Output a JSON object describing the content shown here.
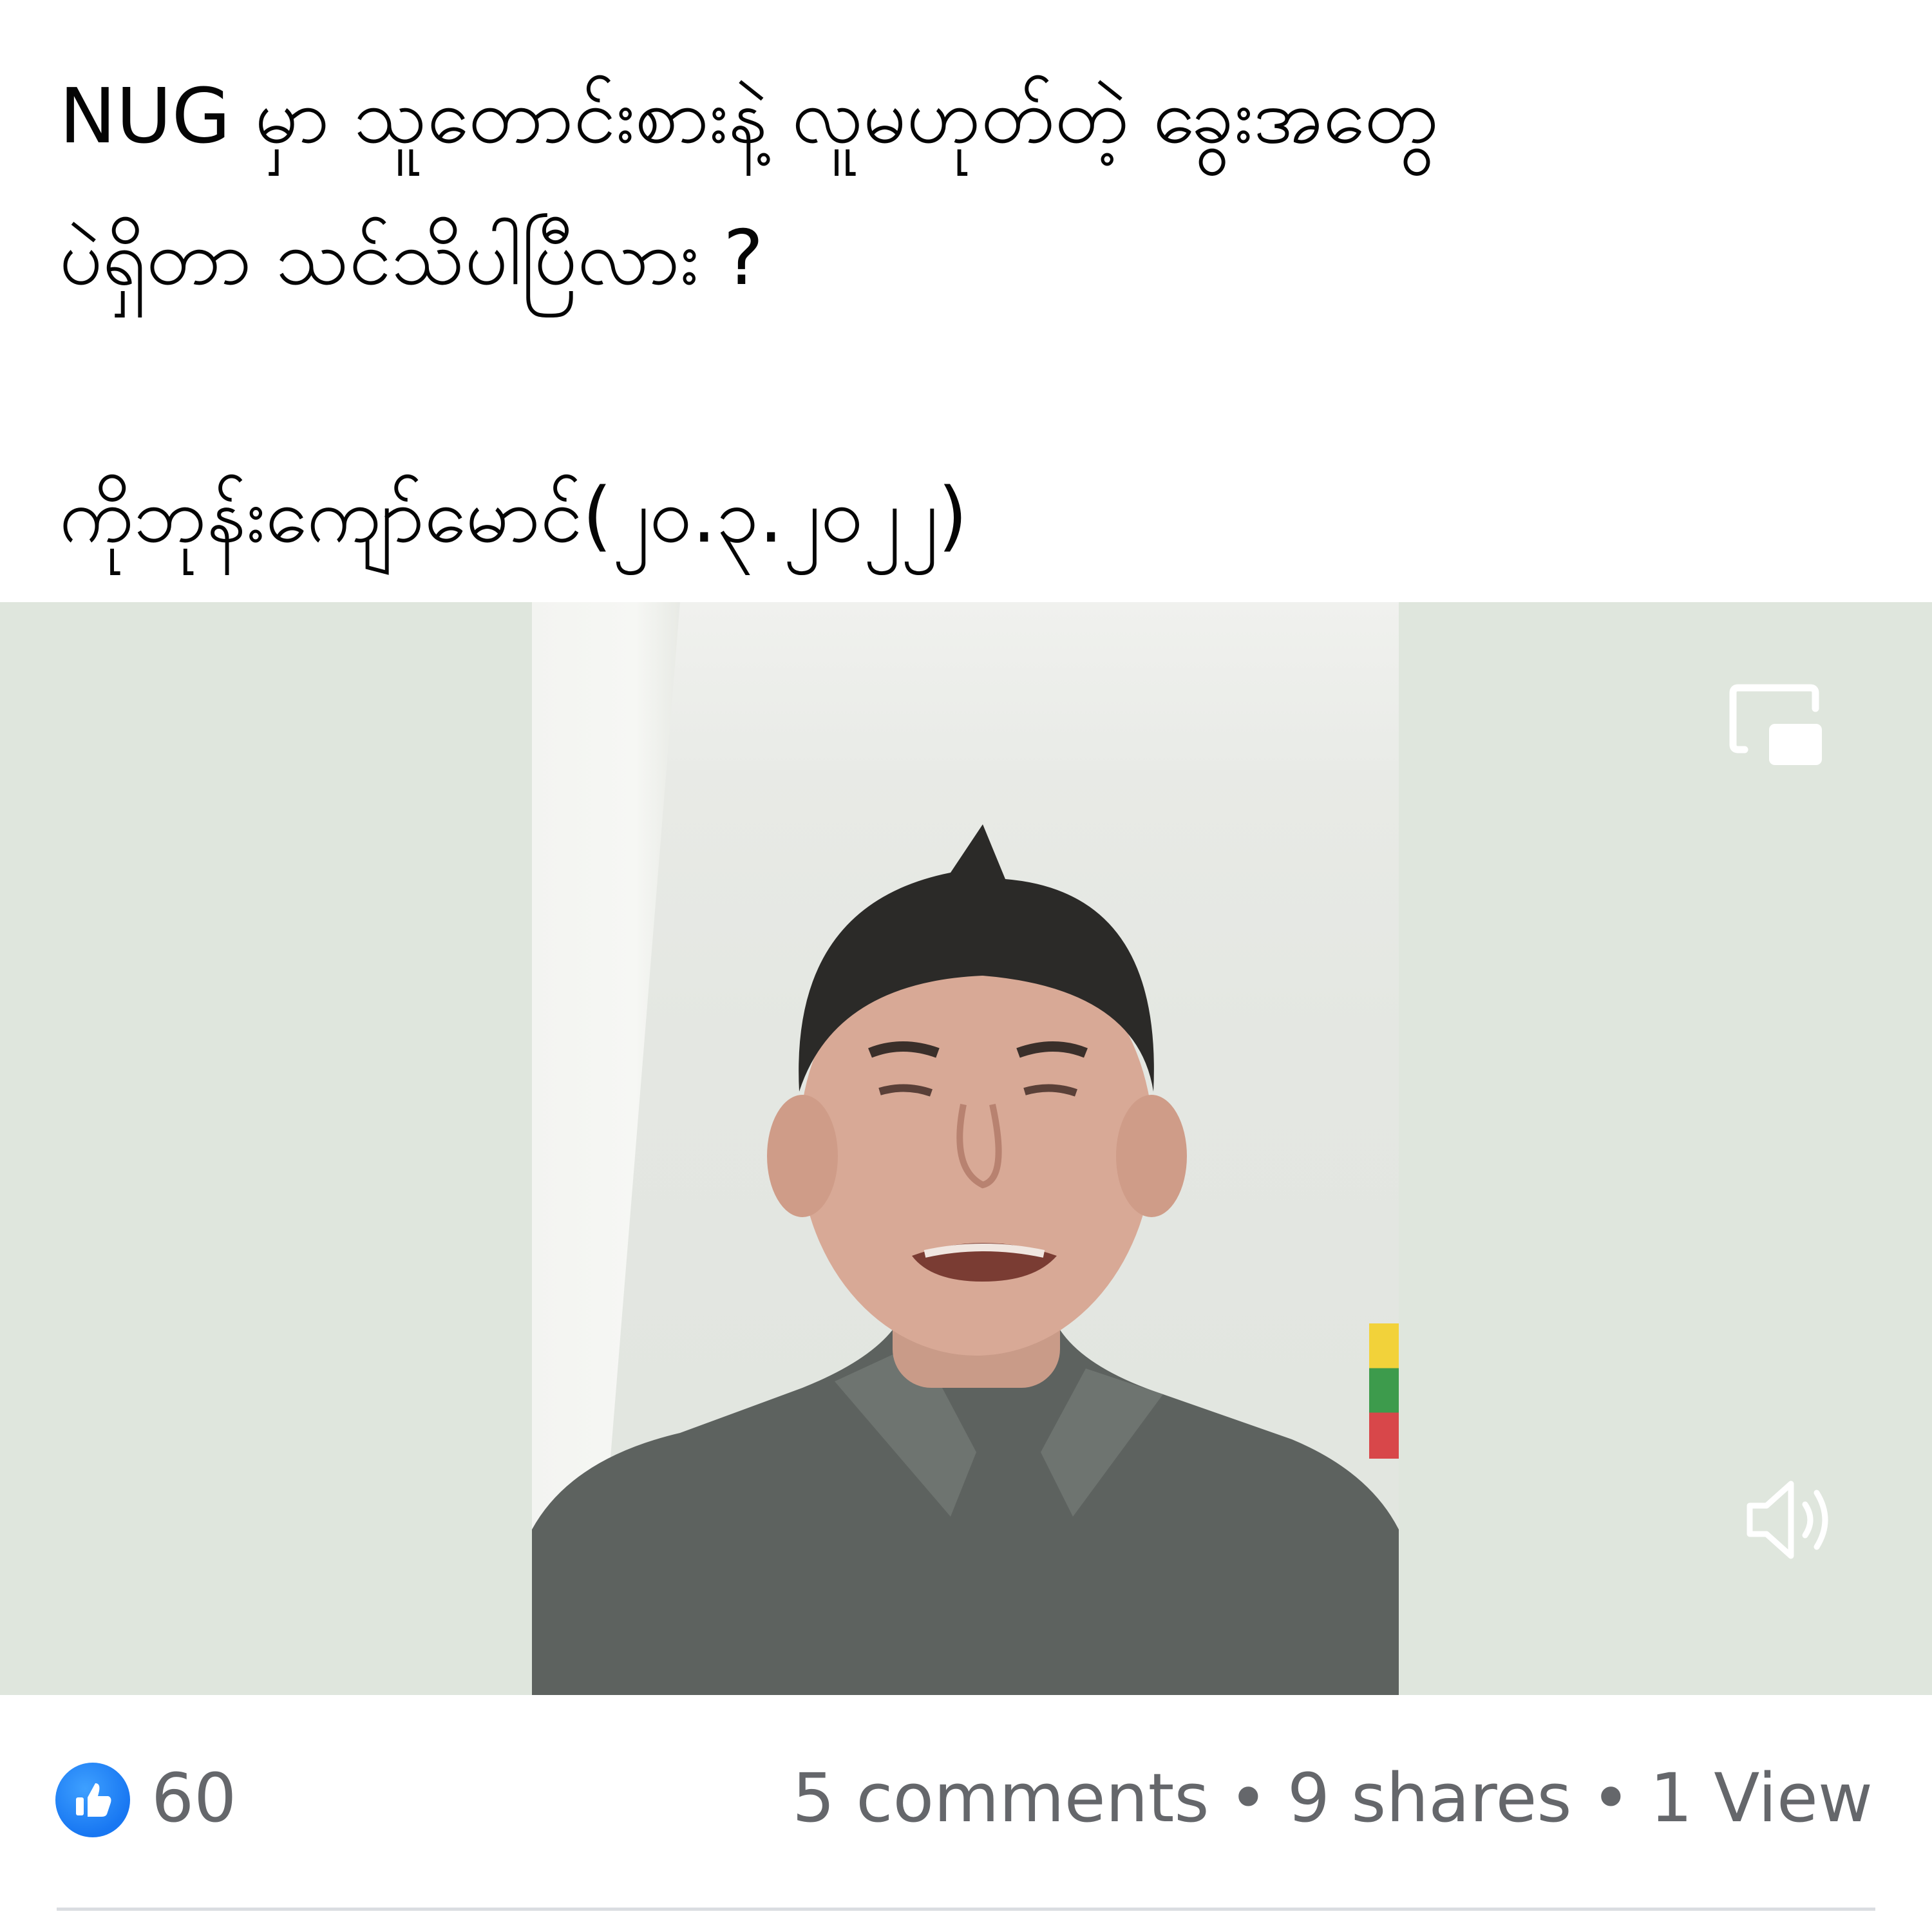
{
  "post": {
    "line1": "NUG မှာ သူတောင်းစားနဲ့ လူမဟုတ်တဲ့ ခွေးအတွေ",
    "line2": "ပဲရှိတာ သင်သိပါပြီလား ?",
    "line3": "ကိုဘုန်းကျော်မောင်(၂၀.၃.၂၀၂၂)"
  },
  "video": {
    "pip_icon": "picture-in-picture-icon",
    "volume_icon": "volume-icon"
  },
  "stats": {
    "like_icon": "thumbs-up-icon",
    "like_count": "60",
    "comments": "5 comments",
    "separator": "•",
    "shares": "9 shares",
    "views": "1 View"
  },
  "colors": {
    "like_blue": "#1877f2",
    "secondary_text": "#65676b",
    "video_bg": "#dfe6dd"
  }
}
